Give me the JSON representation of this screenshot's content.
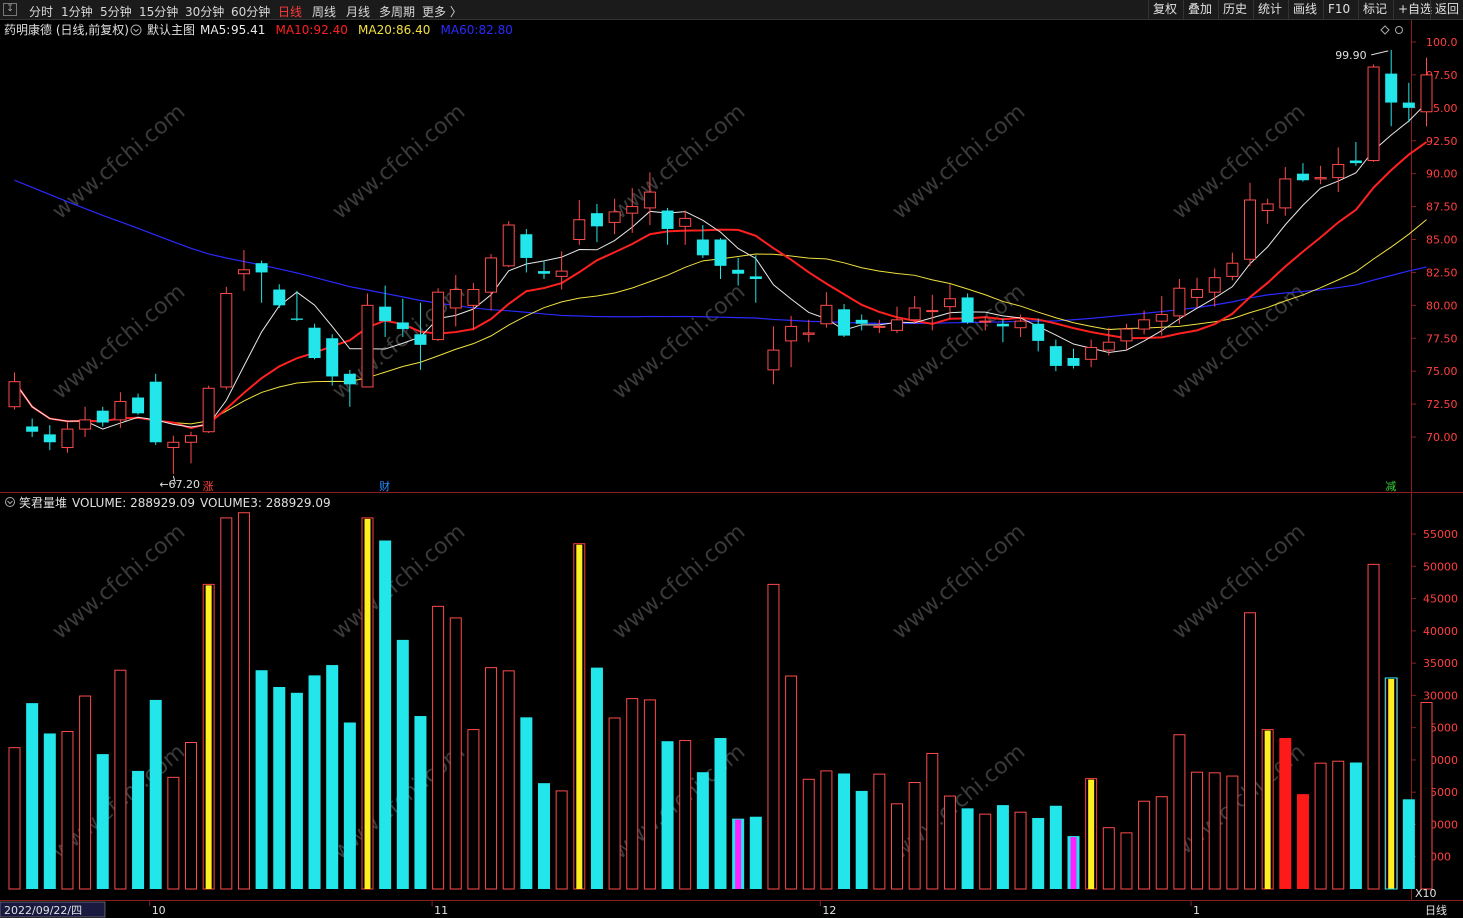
{
  "toolbar": {
    "timeframes": [
      "分时",
      "1分钟",
      "5分钟",
      "15分钟",
      "30分钟",
      "60分钟",
      "日线",
      "周线",
      "月线",
      "多周期",
      "更多 〉"
    ],
    "active_timeframe": "日线",
    "buttons": [
      "复权",
      "叠加",
      "历史",
      "统计",
      "画线",
      "F10",
      "标记",
      "+自选",
      "返回"
    ]
  },
  "main_chart": {
    "stock_label": "药明康德 (日线,前复权)",
    "indicator_name": "默认主图",
    "ma": [
      {
        "label": "MA5:",
        "value": "95.41",
        "color": "#e8e8e8"
      },
      {
        "label": "MA10:",
        "value": "92.40",
        "color": "#ff2020"
      },
      {
        "label": "MA20:",
        "value": "86.40",
        "color": "#f0e040"
      },
      {
        "label": "MA60:",
        "value": "82.80",
        "color": "#2a2aff"
      }
    ],
    "price_ticks": [
      "100.0",
      "97.50",
      "95.00",
      "92.50",
      "90.00",
      "87.50",
      "85.00",
      "82.50",
      "80.00",
      "77.50",
      "75.00",
      "72.50",
      "70.00"
    ],
    "high_marker": "99.90",
    "low_marker": "67.20",
    "event_markers": [
      "涨",
      "财",
      "减"
    ],
    "watermark": "www.cfchi.com"
  },
  "volume_chart": {
    "indicator_name": "笑君量堆",
    "volume_label": "VOLUME: 288929.09",
    "volume3_label": "VOLUME3: 288929.09",
    "ticks": [
      "55000",
      "50000",
      "45000",
      "40000",
      "35000",
      "30000",
      "25000",
      "20000",
      "15000",
      "10000",
      "5000"
    ],
    "unit": "X10"
  },
  "date_axis": {
    "cursor_date": "2022/09/22/四",
    "month_labels": [
      "10",
      "11",
      "12",
      "1"
    ],
    "period_label": "日线"
  },
  "chart_data": {
    "type": "candlestick",
    "price_range": [
      67,
      101
    ],
    "volume_range": [
      0,
      59500
    ],
    "candles": [
      {
        "o": 72.3,
        "h": 74.9,
        "l": 72.1,
        "c": 74.2,
        "v": 21900
      },
      {
        "o": 70.8,
        "h": 71.4,
        "l": 70.0,
        "c": 70.4,
        "v": 28800
      },
      {
        "o": 70.2,
        "h": 70.9,
        "l": 69.0,
        "c": 69.6,
        "v": 24100
      },
      {
        "o": 69.2,
        "h": 71.1,
        "l": 68.8,
        "c": 70.6,
        "v": 24400
      },
      {
        "o": 70.6,
        "h": 72.3,
        "l": 70.0,
        "c": 71.3,
        "v": 29900
      },
      {
        "o": 72.0,
        "h": 72.3,
        "l": 70.8,
        "c": 71.1,
        "v": 20900
      },
      {
        "o": 71.3,
        "h": 73.4,
        "l": 70.7,
        "c": 72.7,
        "v": 33900
      },
      {
        "o": 73.0,
        "h": 73.3,
        "l": 71.7,
        "c": 71.8,
        "v": 18300
      },
      {
        "o": 74.2,
        "h": 74.8,
        "l": 69.4,
        "c": 69.6,
        "v": 29300
      },
      {
        "o": 69.2,
        "h": 70.1,
        "l": 67.2,
        "c": 69.6,
        "v": 17300
      },
      {
        "o": 69.6,
        "h": 70.4,
        "l": 68.0,
        "c": 70.1,
        "v": 22700
      },
      {
        "o": 70.4,
        "h": 73.9,
        "l": 70.3,
        "c": 73.7,
        "v": 47200
      },
      {
        "o": 73.8,
        "h": 81.4,
        "l": 73.6,
        "c": 80.9,
        "v": 57500
      },
      {
        "o": 82.4,
        "h": 84.2,
        "l": 81.1,
        "c": 82.7,
        "v": 58300
      },
      {
        "o": 83.2,
        "h": 83.4,
        "l": 80.2,
        "c": 82.5,
        "v": 33900
      },
      {
        "o": 81.2,
        "h": 81.6,
        "l": 79.8,
        "c": 80.0,
        "v": 31300
      },
      {
        "o": 79.0,
        "h": 81.1,
        "l": 78.8,
        "c": 78.9,
        "v": 30400
      },
      {
        "o": 78.3,
        "h": 78.6,
        "l": 75.9,
        "c": 76.0,
        "v": 33100
      },
      {
        "o": 77.5,
        "h": 77.8,
        "l": 73.9,
        "c": 74.6,
        "v": 34700
      },
      {
        "o": 74.8,
        "h": 75.1,
        "l": 72.3,
        "c": 74.0,
        "v": 25800
      },
      {
        "o": 73.8,
        "h": 80.9,
        "l": 73.8,
        "c": 80.0,
        "v": 57500
      },
      {
        "o": 79.9,
        "h": 81.5,
        "l": 77.6,
        "c": 78.8,
        "v": 54000
      },
      {
        "o": 78.7,
        "h": 80.5,
        "l": 77.6,
        "c": 78.2,
        "v": 38600
      },
      {
        "o": 77.8,
        "h": 80.2,
        "l": 75.1,
        "c": 77.0,
        "v": 26800
      },
      {
        "o": 77.4,
        "h": 81.3,
        "l": 77.3,
        "c": 81.0,
        "v": 43800
      },
      {
        "o": 79.8,
        "h": 82.3,
        "l": 78.4,
        "c": 81.2,
        "v": 42000
      },
      {
        "o": 80.0,
        "h": 81.7,
        "l": 78.1,
        "c": 81.2,
        "v": 24700
      },
      {
        "o": 81.0,
        "h": 83.9,
        "l": 79.6,
        "c": 83.6,
        "v": 34300
      },
      {
        "o": 83.0,
        "h": 86.4,
        "l": 82.9,
        "c": 86.1,
        "v": 33800
      },
      {
        "o": 85.4,
        "h": 85.8,
        "l": 82.5,
        "c": 83.6,
        "v": 26600
      },
      {
        "o": 82.6,
        "h": 83.4,
        "l": 82.0,
        "c": 82.4,
        "v": 16400
      },
      {
        "o": 82.2,
        "h": 84.1,
        "l": 81.2,
        "c": 82.6,
        "v": 15200
      },
      {
        "o": 85.0,
        "h": 88.0,
        "l": 84.6,
        "c": 86.5,
        "v": 53500
      },
      {
        "o": 87.0,
        "h": 87.7,
        "l": 84.8,
        "c": 86.0,
        "v": 34300
      },
      {
        "o": 86.3,
        "h": 88.1,
        "l": 85.4,
        "c": 87.1,
        "v": 26500
      },
      {
        "o": 87.0,
        "h": 88.9,
        "l": 85.5,
        "c": 87.5,
        "v": 29500
      },
      {
        "o": 87.4,
        "h": 90.1,
        "l": 86.1,
        "c": 88.6,
        "v": 29300
      },
      {
        "o": 87.2,
        "h": 87.4,
        "l": 84.6,
        "c": 85.8,
        "v": 22900
      },
      {
        "o": 86.0,
        "h": 87.2,
        "l": 84.6,
        "c": 86.6,
        "v": 23000
      },
      {
        "o": 85.0,
        "h": 86.1,
        "l": 83.6,
        "c": 83.8,
        "v": 18100
      },
      {
        "o": 85.0,
        "h": 85.1,
        "l": 82.0,
        "c": 83.0,
        "v": 23400
      },
      {
        "o": 82.7,
        "h": 83.6,
        "l": 81.5,
        "c": 82.4,
        "v": 10900
      },
      {
        "o": 82.2,
        "h": 83.8,
        "l": 80.2,
        "c": 82.0,
        "v": 11200
      },
      {
        "o": 75.1,
        "h": 78.4,
        "l": 74.0,
        "c": 76.6,
        "v": 47200
      },
      {
        "o": 77.3,
        "h": 79.2,
        "l": 75.3,
        "c": 78.4,
        "v": 33000
      },
      {
        "o": 77.8,
        "h": 78.9,
        "l": 77.2,
        "c": 77.9,
        "v": 17000
      },
      {
        "o": 78.6,
        "h": 81.0,
        "l": 78.3,
        "c": 80.0,
        "v": 18300
      },
      {
        "o": 79.7,
        "h": 80.1,
        "l": 77.6,
        "c": 77.7,
        "v": 17900
      },
      {
        "o": 78.9,
        "h": 79.3,
        "l": 78.1,
        "c": 78.6,
        "v": 15200
      },
      {
        "o": 78.4,
        "h": 78.9,
        "l": 77.9,
        "c": 78.4,
        "v": 17800
      },
      {
        "o": 78.1,
        "h": 79.9,
        "l": 77.9,
        "c": 78.9,
        "v": 13200
      },
      {
        "o": 78.9,
        "h": 80.7,
        "l": 78.6,
        "c": 79.8,
        "v": 16500
      },
      {
        "o": 79.6,
        "h": 80.8,
        "l": 78.1,
        "c": 79.6,
        "v": 21000
      },
      {
        "o": 79.9,
        "h": 81.6,
        "l": 79.0,
        "c": 80.5,
        "v": 14400
      },
      {
        "o": 80.6,
        "h": 80.9,
        "l": 78.6,
        "c": 78.7,
        "v": 12500
      },
      {
        "o": 78.8,
        "h": 79.2,
        "l": 78.1,
        "c": 78.8,
        "v": 11600
      },
      {
        "o": 78.6,
        "h": 79.0,
        "l": 77.2,
        "c": 78.4,
        "v": 13000
      },
      {
        "o": 78.3,
        "h": 79.3,
        "l": 77.6,
        "c": 78.8,
        "v": 11900
      },
      {
        "o": 78.6,
        "h": 79.0,
        "l": 76.5,
        "c": 77.3,
        "v": 11000
      },
      {
        "o": 76.9,
        "h": 77.4,
        "l": 75.0,
        "c": 75.4,
        "v": 12900
      },
      {
        "o": 76.0,
        "h": 76.7,
        "l": 75.2,
        "c": 75.4,
        "v": 8200
      },
      {
        "o": 75.9,
        "h": 77.4,
        "l": 75.3,
        "c": 76.8,
        "v": 17100
      },
      {
        "o": 76.6,
        "h": 78.3,
        "l": 76.2,
        "c": 77.2,
        "v": 9500
      },
      {
        "o": 77.3,
        "h": 78.6,
        "l": 76.6,
        "c": 78.2,
        "v": 8700
      },
      {
        "o": 78.2,
        "h": 79.6,
        "l": 77.8,
        "c": 78.9,
        "v": 13600
      },
      {
        "o": 78.8,
        "h": 80.7,
        "l": 77.7,
        "c": 79.3,
        "v": 14300
      },
      {
        "o": 79.2,
        "h": 82.0,
        "l": 78.6,
        "c": 81.3,
        "v": 23900
      },
      {
        "o": 80.6,
        "h": 82.1,
        "l": 79.8,
        "c": 81.2,
        "v": 18100
      },
      {
        "o": 81.0,
        "h": 82.8,
        "l": 79.9,
        "c": 82.1,
        "v": 18000
      },
      {
        "o": 82.2,
        "h": 84.0,
        "l": 81.9,
        "c": 83.2,
        "v": 17500
      },
      {
        "o": 83.5,
        "h": 89.3,
        "l": 83.0,
        "c": 88.0,
        "v": 42800
      },
      {
        "o": 87.2,
        "h": 88.1,
        "l": 86.2,
        "c": 87.7,
        "v": 24700
      },
      {
        "o": 87.4,
        "h": 90.5,
        "l": 86.8,
        "c": 89.6,
        "v": 23400
      },
      {
        "o": 90.0,
        "h": 90.8,
        "l": 89.4,
        "c": 89.5,
        "v": 14700
      },
      {
        "o": 89.6,
        "h": 90.6,
        "l": 89.2,
        "c": 89.7,
        "v": 19500
      },
      {
        "o": 89.7,
        "h": 92.0,
        "l": 88.6,
        "c": 90.7,
        "v": 19800
      },
      {
        "o": 91.0,
        "h": 92.4,
        "l": 90.6,
        "c": 90.8,
        "v": 19600
      },
      {
        "o": 91.0,
        "h": 98.3,
        "l": 90.9,
        "c": 98.1,
        "v": 50300
      },
      {
        "o": 97.6,
        "h": 99.4,
        "l": 93.6,
        "c": 95.4,
        "v": 32700
      },
      {
        "o": 95.4,
        "h": 96.9,
        "l": 93.9,
        "c": 95.0,
        "v": 13900
      },
      {
        "o": 94.7,
        "h": 98.8,
        "l": 93.6,
        "c": 97.5,
        "v": 28900
      }
    ]
  }
}
